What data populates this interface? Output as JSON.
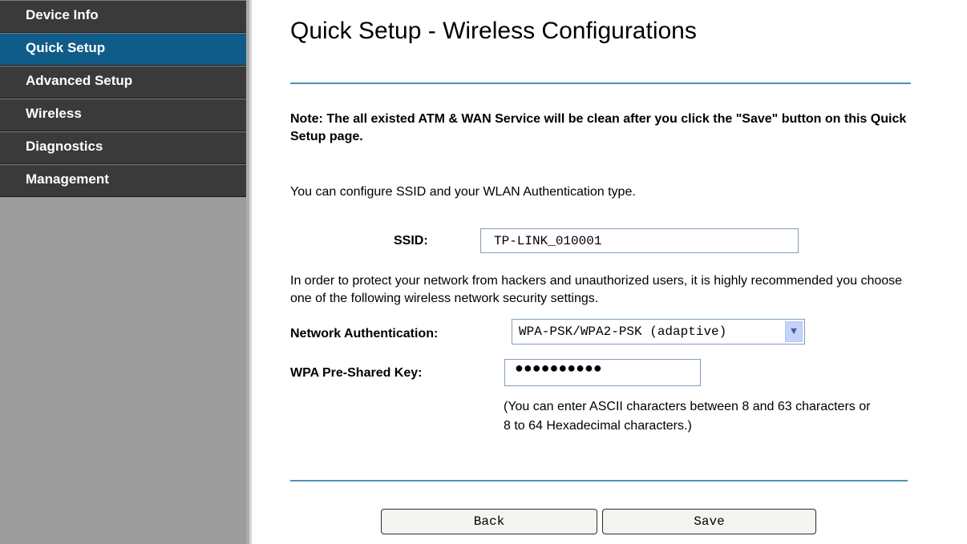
{
  "sidebar": {
    "items": [
      {
        "label": "Device Info"
      },
      {
        "label": "Quick Setup"
      },
      {
        "label": "Advanced Setup"
      },
      {
        "label": "Wireless"
      },
      {
        "label": "Diagnostics"
      },
      {
        "label": "Management"
      }
    ],
    "active_index": 1,
    "active_color": "#105c88"
  },
  "main": {
    "title": "Quick Setup - Wireless Configurations",
    "note": "Note: The all existed ATM & WAN Service will be clean after you click the \"Save\" button on this Quick Setup page.",
    "intro": "You can configure SSID and your WLAN Authentication type.",
    "ssid": {
      "label": "SSID:",
      "value": "TP-LINK_010001"
    },
    "protect_text": "In order to protect your network from hackers and unauthorized users, it is highly recommended you choose one of the following wireless network security settings.",
    "auth": {
      "label": "Network Authentication:",
      "value": "WPA-PSK/WPA2-PSK (adaptive)"
    },
    "psk": {
      "label": "WPA Pre-Shared Key:",
      "value": "●●●●●●●●●●",
      "hint": "(You can enter ASCII characters between 8 and 63 characters or 8 to 64 Hexadecimal characters.)"
    },
    "buttons": {
      "back": "Back",
      "save": "Save"
    }
  }
}
